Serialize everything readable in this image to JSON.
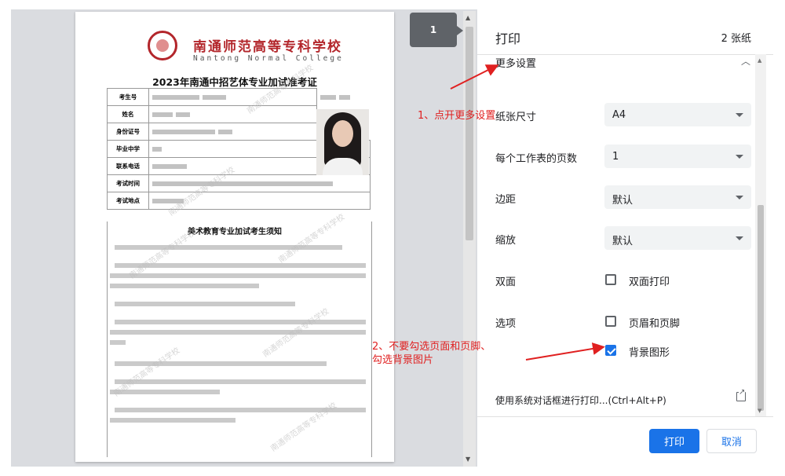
{
  "preview": {
    "page_number": "1",
    "school_name_cn": "南通师范高等专科学校",
    "school_name_en": "Nantong Normal College",
    "ticket_title": "2023年南通中招艺体专业加试准考证",
    "field_labels": [
      "考生号",
      "姓名",
      "身份证号",
      "毕业中学",
      "联系电话",
      "考试时间",
      "考试地点"
    ],
    "notice_title": "美术教育专业加试考生须知"
  },
  "sidebar": {
    "title": "打印",
    "sheet_count": "2 张纸",
    "more_settings": "更多设置",
    "rows": [
      {
        "label": "纸张尺寸",
        "value": "A4"
      },
      {
        "label": "每个工作表的页数",
        "value": "1"
      },
      {
        "label": "边距",
        "value": "默认"
      },
      {
        "label": "缩放",
        "value": "默认"
      }
    ],
    "duplex": {
      "label": "双面",
      "option": "双面打印",
      "checked": false
    },
    "options": {
      "label": "选项",
      "header_footer": "页眉和页脚",
      "header_footer_checked": false,
      "background": "背景图形",
      "background_checked": true
    },
    "system_dialog": "使用系统对话框进行打印...(Ctrl+Alt+P)",
    "print_button": "打印",
    "cancel_button": "取消"
  },
  "annotations": {
    "step1": "1、点开更多设置",
    "step2_line1": "2、不要勾选页面和页脚、",
    "step2_line2": "勾选背景图片",
    "color": "#e02020"
  },
  "colors": {
    "accent": "#1a73e8",
    "seal_red": "#b3262b"
  }
}
